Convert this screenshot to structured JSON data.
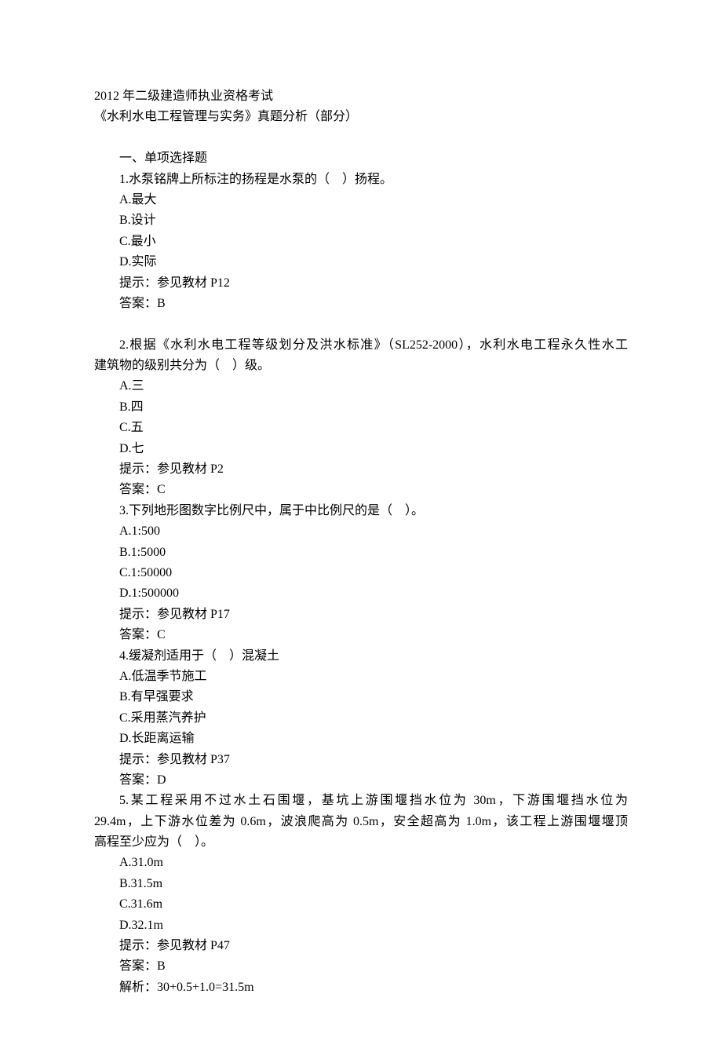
{
  "header": {
    "line1": "2012 年二级建造师执业资格考试",
    "line2": "《水利水电工程管理与实务》真题分析（部分）"
  },
  "section_heading": "一、单项选择题",
  "questions": [
    {
      "stem": "1.水泵铭牌上所标注的扬程是水泵的（　）扬程。",
      "options": [
        "A.最大",
        "B.设计",
        "C.最小",
        "D.实际"
      ],
      "hint": "提示：参见教材 P12",
      "answer": "答案：B"
    },
    {
      "stem_line1": "2.根据《水利水电工程等级划分及洪水标准》（SL252-2000），水利水电工程永久性水工",
      "stem_line2": "建筑物的级别共分为（　）级。",
      "options": [
        "A.三",
        "B.四",
        "C.五",
        "D.七"
      ],
      "hint": "提示：参见教材 P2",
      "answer": "答案：C"
    },
    {
      "stem": "3.下列地形图数字比例尺中，属于中比例尺的是（　）。",
      "options": [
        "A.1:500",
        "B.1:5000",
        "C.1:50000",
        "D.1:500000"
      ],
      "hint": "提示：参见教材 P17",
      "answer": "答案：C"
    },
    {
      "stem": "4.缓凝剂适用于（　）混凝土",
      "options": [
        "A.低温季节施工",
        "B.有早强要求",
        "C.采用蒸汽养护",
        "D.长距离运输"
      ],
      "hint": "提示：参见教材 P37",
      "answer": "答案：D"
    },
    {
      "stem_line1": "5.某工程采用不过水土石围堰，基坑上游围堰挡水位为 30m，下游围堰挡水位为",
      "stem_line2": "29.4m，上下游水位差为 0.6m，波浪爬高为 0.5m，安全超高为 1.0m，该工程上游围堰堰顶",
      "stem_line3": "高程至少应为（　）。",
      "options": [
        "A.31.0m",
        "B.31.5m",
        "C.31.6m",
        "D.32.1m"
      ],
      "hint": "提示：参见教材 P47",
      "answer": "答案：B",
      "analysis": "解析：30+0.5+1.0=31.5m"
    }
  ]
}
